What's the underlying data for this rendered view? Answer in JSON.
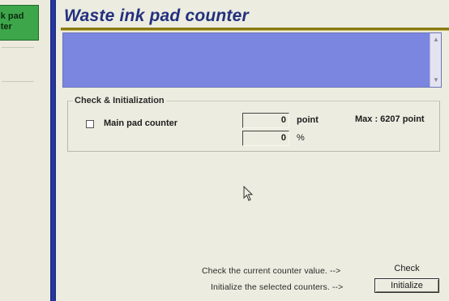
{
  "sidebar": {
    "active_item": {
      "line1": "nk pad",
      "line2": "nter"
    }
  },
  "main": {
    "title": "Waste ink pad counter"
  },
  "check_group": {
    "legend": "Check & Initialization",
    "counter": {
      "label": "Main pad counter",
      "checked": false,
      "value_points": "0",
      "unit_points": "point",
      "value_percent": "0",
      "unit_percent": "%",
      "max_text": "Max : 6207 point"
    }
  },
  "actions": {
    "check_text": "Check the current counter value. -->",
    "check_button": "Check",
    "init_text": "Initialize the selected counters. -->",
    "init_button": "Initialize"
  },
  "colors": {
    "title": "#22307e",
    "sidebar_active": "#3ea64a",
    "separator": "#2a3ca8",
    "description_box": "#7b86e0"
  }
}
